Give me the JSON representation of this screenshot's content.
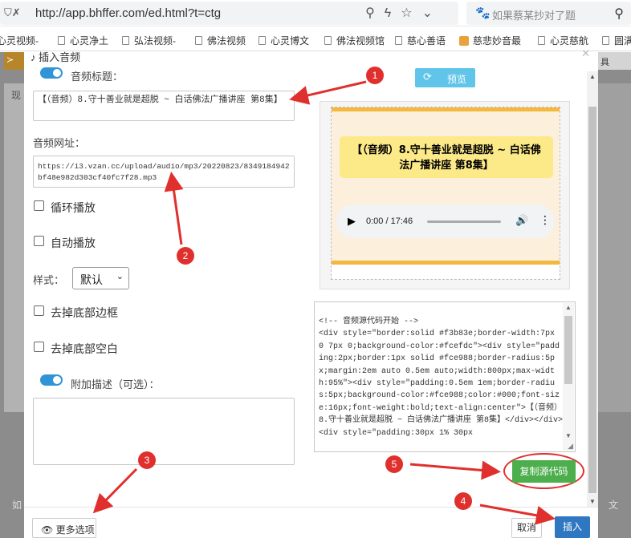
{
  "browser": {
    "security_icon": "shield-icon",
    "url": "http://app.bhffer.com/ed.html?t=ctg",
    "search_placeholder": "如果蔡某抄对了题",
    "bookmarks": [
      "心灵视频-",
      "心灵净土",
      "弘法视频-",
      "佛法视频",
      "心灵博文",
      "佛法视频馆",
      "慈心善语",
      "慈悲妙音最",
      "心灵慈航",
      "圆满"
    ]
  },
  "background": {
    "left_text": "现",
    "right_button": "具",
    "bottom_left": "如",
    "bottom_right": "文"
  },
  "modal": {
    "title": "插入音频",
    "audio_title_label": "音频标题：",
    "audio_title_value": "【（音频）8.守十善业就是超脱 ~ 白话佛法广播讲座 第8集】",
    "audio_url_label": "音频网址：",
    "audio_url_value": "https://i3.vzan.cc/upload/audio/mp3/20220823/8349184942bf48e982d303cf40fc7f28.mp3",
    "loop_label": "循环播放",
    "autoplay_label": "自动播放",
    "style_label": "样式：",
    "style_value": "默认",
    "remove_border_label": "去掉底部边框",
    "remove_space_label": "去掉底部空白",
    "extra_desc_label": "附加描述（可选）：",
    "preview_button": "预览",
    "preview_title": "【（音频）8.守十善业就是超脱 ~ 白话佛法广播讲座 第8集】",
    "player_time": "0:00 / 17:46",
    "source_code": "<!-- 音频源代码开始 -->\n<div style=\"border:solid #f3b83e;border-width:7px 0 7px 0;background-color:#fcefdc\"><div style=\"padding:2px;border:1px solid #fce988;border-radius:5px;margin:2em auto 0.5em auto;width:800px;max-width:95%\"><div style=\"padding:0.5em 1em;border-radius:5px;background-color:#fce988;color:#000;font-size:16px;font-weight:bold;text-align:center\">【（音频）8.守十善业就是超脱 ~ 白话佛法广播讲座 第8集】</div></div><div style=\"padding:30px 1% 30px",
    "copy_button": "复制源代码",
    "more_options": "更多选项",
    "cancel": "取消",
    "insert": "插入"
  },
  "annotations": [
    "1",
    "2",
    "3",
    "4",
    "5"
  ],
  "colors": {
    "accent_blue": "#2f95d6",
    "preview_border": "#f3b83e",
    "preview_bg": "#fcefdc",
    "title_bg": "#fce988",
    "copy_green": "#4cae4c",
    "insert_blue": "#2f77c0",
    "marker_red": "#e0302d"
  }
}
